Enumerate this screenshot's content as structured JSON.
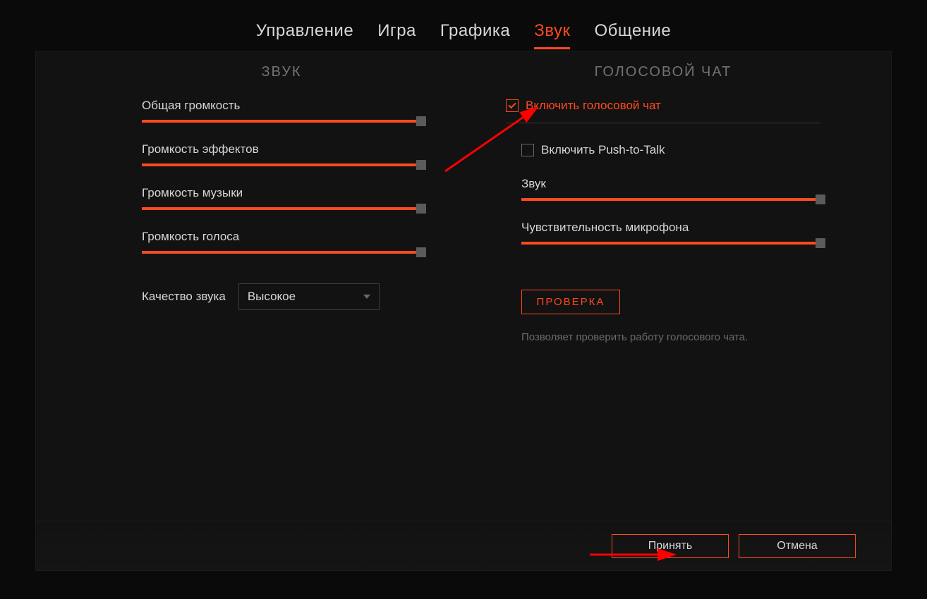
{
  "tabs": {
    "control": "Управление",
    "game": "Игра",
    "graphics": "Графика",
    "sound": "Звук",
    "communication": "Общение",
    "active": "sound"
  },
  "left": {
    "title": "ЗВУК",
    "sliders": {
      "master": {
        "label": "Общая громкость",
        "value": 100
      },
      "effects": {
        "label": "Громкость эффектов",
        "value": 100
      },
      "music": {
        "label": "Громкость музыки",
        "value": 100
      },
      "voice": {
        "label": "Громкость голоса",
        "value": 100
      }
    },
    "quality": {
      "label": "Качество звука",
      "value": "Высокое"
    }
  },
  "right": {
    "title": "ГОЛОСОВОЙ ЧАТ",
    "enable_voice": {
      "label": "Включить голосовой чат",
      "checked": true
    },
    "push_to_talk": {
      "label": "Включить Push-to-Talk",
      "checked": false
    },
    "sliders": {
      "sound": {
        "label": "Звук",
        "value": 100
      },
      "mic": {
        "label": "Чувствительность микрофона",
        "value": 100
      }
    },
    "test_button": "ПРОВЕРКА",
    "help": "Позволяет проверить работу голосового чата."
  },
  "footer": {
    "accept": "Принять",
    "cancel": "Отмена"
  },
  "colors": {
    "accent": "#ff4a1f"
  }
}
